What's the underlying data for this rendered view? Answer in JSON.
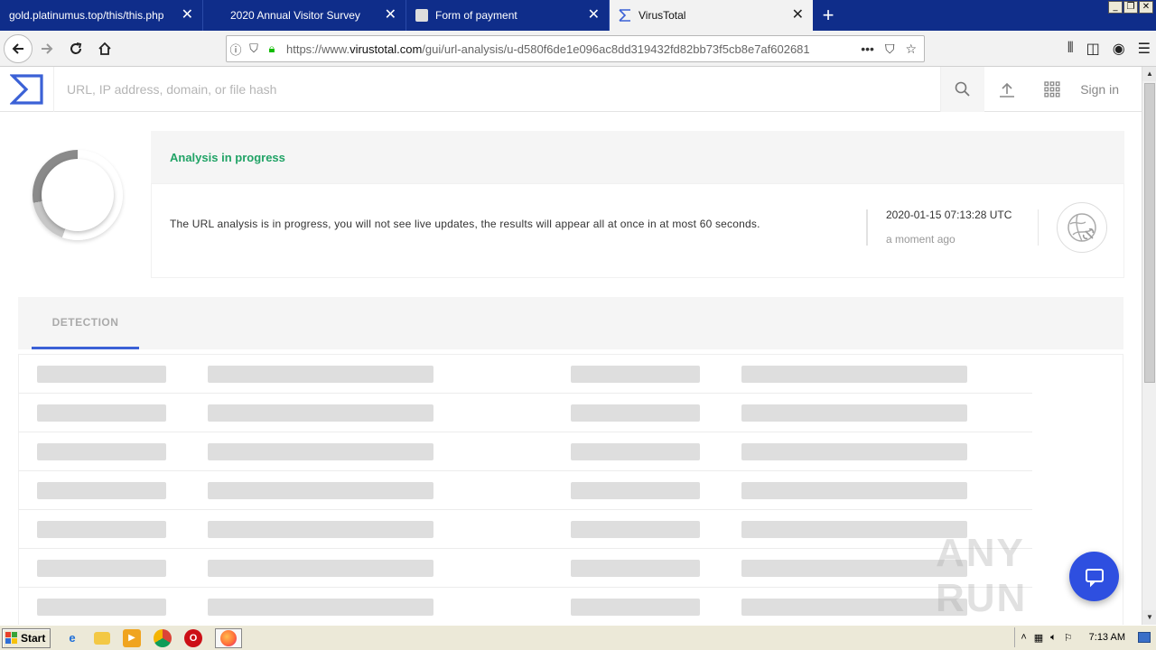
{
  "browser": {
    "tabs": [
      {
        "title": "gold.platinumus.top/this/this.php",
        "close": "✕"
      },
      {
        "title": "2020 Annual Visitor Survey",
        "close": "✕"
      },
      {
        "title": "Form of payment",
        "close": "✕"
      },
      {
        "title": "VirusTotal",
        "close": "✕",
        "active": true
      }
    ],
    "new_tab": "+",
    "url_prefix": "https://www.",
    "url_domain": "virustotal.com",
    "url_path": "/gui/url-analysis/u-d580f6de1e096ac8dd319432fd82bb73f5cb8e7af602681",
    "page_actions": "•••"
  },
  "vt": {
    "search_placeholder": "URL, IP address, domain, or file hash",
    "signin": "Sign in",
    "brand_color": "#3b61d6"
  },
  "analysis": {
    "status": "Analysis in progress",
    "message": "The URL analysis is in progress, you will not see live updates, the results will appear all at once in at most 60 seconds.",
    "date": "2020-01-15 07:13:28 UTC",
    "relative": "a moment ago",
    "status_color": "#21a366"
  },
  "tabs": {
    "detection": "DETECTION"
  },
  "watermark": "ANY RUN",
  "taskbar": {
    "start": "Start",
    "clock": "7:13 AM"
  }
}
